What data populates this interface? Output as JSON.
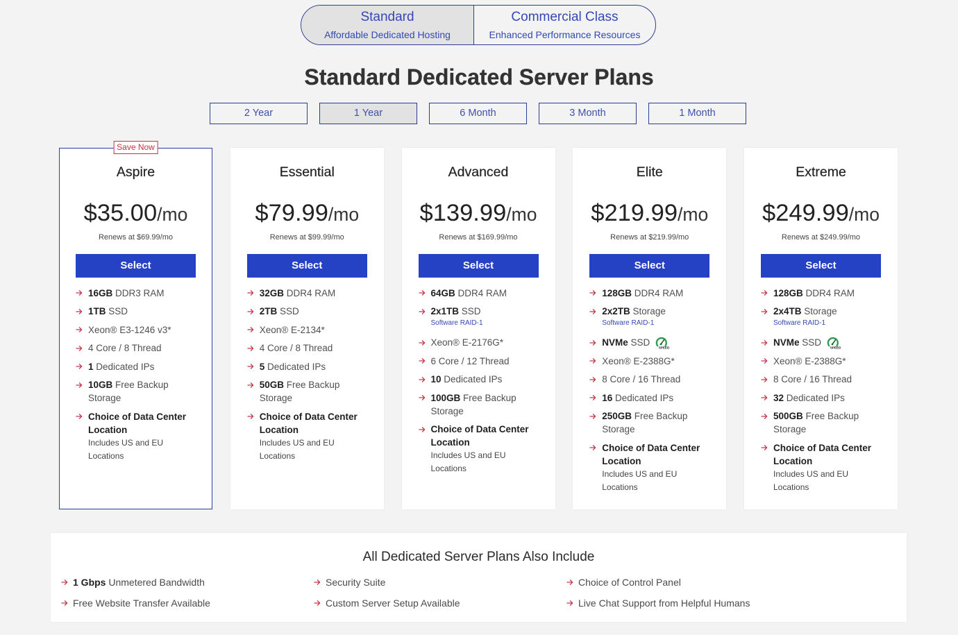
{
  "hosting_toggle": {
    "options": [
      {
        "title": "Standard",
        "subtitle": "Affordable Dedicated Hosting",
        "selected": true
      },
      {
        "title": "Commercial Class",
        "subtitle": "Enhanced Performance Resources",
        "selected": false
      }
    ]
  },
  "page_title": "Standard Dedicated Server Plans",
  "term_tabs": [
    {
      "label": "2 Year",
      "selected": false
    },
    {
      "label": "1 Year",
      "selected": true
    },
    {
      "label": "6 Month",
      "selected": false
    },
    {
      "label": "3 Month",
      "selected": false
    },
    {
      "label": "1 Month",
      "selected": false
    }
  ],
  "plans": [
    {
      "name": "Aspire",
      "badge": "Save Now",
      "highlighted": true,
      "price": "$35.00",
      "period": "/mo",
      "renews": "Renews at $69.99/mo",
      "select_label": "Select",
      "features": [
        {
          "bold": "16GB",
          "text": "DDR3 RAM"
        },
        {
          "bold": "1TB",
          "text": "SSD"
        },
        {
          "text": "Xeon® E3-1246 v3*"
        },
        {
          "text": "4 Core / 8 Thread"
        },
        {
          "bold": "1",
          "text": "Dedicated IPs"
        },
        {
          "bold": "10GB",
          "text": "Free Backup Storage"
        },
        {
          "bold": "Choice of Data Center Location",
          "detail": "Includes US and EU Locations"
        }
      ]
    },
    {
      "name": "Essential",
      "highlighted": false,
      "price": "$79.99",
      "period": "/mo",
      "renews": "Renews at $99.99/mo",
      "select_label": "Select",
      "features": [
        {
          "bold": "32GB",
          "text": "DDR4 RAM"
        },
        {
          "bold": "2TB",
          "text": "SSD"
        },
        {
          "text": "Xeon® E-2134*"
        },
        {
          "text": "4 Core / 8 Thread"
        },
        {
          "bold": "5",
          "text": "Dedicated IPs"
        },
        {
          "bold": "50GB",
          "text": "Free Backup Storage"
        },
        {
          "bold": "Choice of Data Center Location",
          "detail": "Includes US and EU Locations"
        }
      ]
    },
    {
      "name": "Advanced",
      "highlighted": false,
      "price": "$139.99",
      "period": "/mo",
      "renews": "Renews at $169.99/mo",
      "select_label": "Select",
      "features": [
        {
          "bold": "64GB",
          "text": "DDR4 RAM"
        },
        {
          "bold": "2x1TB",
          "text": "SSD",
          "note": "Software RAID-1"
        },
        {
          "text": "Xeon® E-2176G*"
        },
        {
          "text": "6 Core / 12 Thread"
        },
        {
          "bold": "10",
          "text": "Dedicated IPs"
        },
        {
          "bold": "100GB",
          "text": "Free Backup Storage"
        },
        {
          "bold": "Choice of Data Center Location",
          "detail": "Includes US and EU Locations"
        }
      ]
    },
    {
      "name": "Elite",
      "highlighted": false,
      "price": "$219.99",
      "period": "/mo",
      "renews": "Renews at $219.99/mo",
      "select_label": "Select",
      "features": [
        {
          "bold": "128GB",
          "text": "DDR4 RAM"
        },
        {
          "bold": "2x2TB",
          "text": "Storage",
          "note": "Software RAID-1"
        },
        {
          "bold": "NVMe",
          "text": "SSD",
          "icon": "speed-gauge-icon",
          "icon_text": "SPEED"
        },
        {
          "text": "Xeon® E-2388G*"
        },
        {
          "text": "8 Core / 16 Thread"
        },
        {
          "bold": "16",
          "text": "Dedicated IPs"
        },
        {
          "bold": "250GB",
          "text": "Free Backup Storage"
        },
        {
          "bold": "Choice of Data Center Location",
          "detail": "Includes US and EU Locations"
        }
      ]
    },
    {
      "name": "Extreme",
      "highlighted": false,
      "price": "$249.99",
      "period": "/mo",
      "renews": "Renews at $249.99/mo",
      "select_label": "Select",
      "features": [
        {
          "bold": "128GB",
          "text": "DDR4 RAM"
        },
        {
          "bold": "2x4TB",
          "text": "Storage",
          "note": "Software RAID-1"
        },
        {
          "bold": "NVMe",
          "text": "SSD",
          "icon": "speed-gauge-icon",
          "icon_text": "SPEED"
        },
        {
          "text": "Xeon® E-2388G*"
        },
        {
          "text": "8 Core / 16 Thread"
        },
        {
          "bold": "32",
          "text": "Dedicated IPs"
        },
        {
          "bold": "500GB",
          "text": "Free Backup Storage"
        },
        {
          "bold": "Choice of Data Center Location",
          "detail": "Includes US and EU Locations"
        }
      ]
    }
  ],
  "includes": {
    "title": "All Dedicated Server Plans Also Include",
    "items": [
      {
        "bold": "1 Gbps",
        "text": "Unmetered Bandwidth"
      },
      {
        "text": "Security Suite"
      },
      {
        "text": "Choice of Control Panel"
      },
      {
        "text": "Free Website Transfer Available"
      },
      {
        "text": "Custom Server Setup Available"
      },
      {
        "text": "Live Chat Support from Helpful Humans"
      }
    ]
  },
  "icons": {
    "bullet": "arrow-right-icon",
    "nvme": "speed-gauge-icon"
  },
  "colors": {
    "page_background": "#f3f3f3",
    "brand_blue": "#2541c4",
    "navy_border": "#2c3d8f",
    "link_blue": "#3347b5",
    "accent_red": "#c8364b",
    "selected_gray": "#e2e2e2",
    "highlight_border": "#2b3ea6"
  }
}
